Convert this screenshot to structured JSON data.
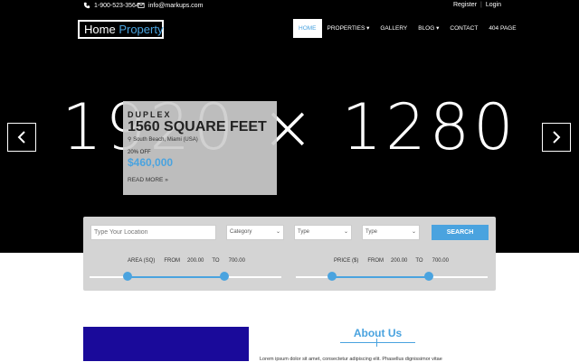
{
  "topbar": {
    "phone": "1-900-523-3564",
    "email": "info@markups.com",
    "register": "Register",
    "separator": "|",
    "login": "Login"
  },
  "logo": {
    "part1": "Home",
    "part2": "Property"
  },
  "nav": {
    "home": "HOME",
    "properties": "PROPERTIES",
    "gallery": "GALLERY",
    "blog": "BLOG",
    "contact": "CONTACT",
    "page404": "404 PAGE"
  },
  "hero": {
    "placeholder": "1920 × 1280",
    "prev_icon": "chevron-left-icon",
    "next_icon": "chevron-right-icon"
  },
  "card": {
    "tag": "DUPLEX",
    "size": "1560 SQUARE FEET",
    "location": "South Beach, Miami (USA)",
    "discount": "20% OFF",
    "price": "$460,000",
    "read_more": "READ MORE"
  },
  "search": {
    "location_placeholder": "Type Your Location",
    "category": "Category",
    "type1": "Type",
    "type2": "Type",
    "button": "SEARCH",
    "area": {
      "label": "AREA (SQ)",
      "from_label": "FROM",
      "from": "200.00",
      "to_label": "TO",
      "to": "700.00"
    },
    "price": {
      "label": "PRICE ($)",
      "from_label": "FROM",
      "from": "200.00",
      "to_label": "TO",
      "to": "700.00"
    }
  },
  "about": {
    "title": "About Us",
    "text": "Lorem ipsum dolor sit amet, consectetur adipiscing elit. Phasellus dignissimor vitae"
  },
  "colors": {
    "accent": "#4aa3df",
    "block": "#1a0a9a",
    "dark": "#000000"
  }
}
